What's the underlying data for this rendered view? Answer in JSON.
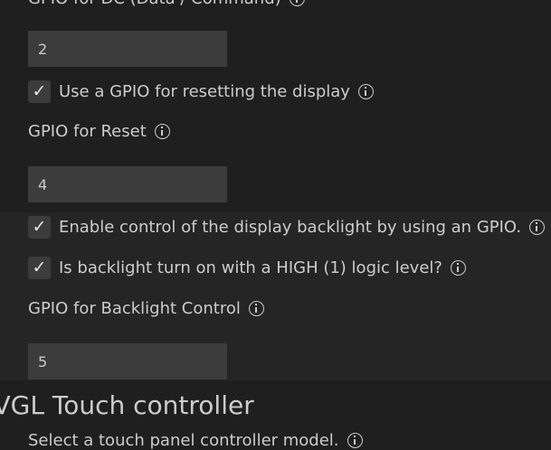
{
  "top_label": {
    "text": "GPIO for DC (Data / Command)"
  },
  "dc_gpio": {
    "value": "2"
  },
  "reset_checkbox": {
    "checked_glyph": "✓",
    "label": "Use a GPIO for resetting the display"
  },
  "reset_gpio_label": {
    "text": "GPIO for Reset"
  },
  "reset_gpio": {
    "value": "4"
  },
  "backlight_enable": {
    "checked_glyph": "✓",
    "label": "Enable control of the display backlight by using an GPIO."
  },
  "backlight_level": {
    "checked_glyph": "✓",
    "label": "Is backlight turn on with a HIGH (1) logic level?"
  },
  "backlight_gpio_label": {
    "text": "GPIO for Backlight Control"
  },
  "backlight_gpio": {
    "value": "5"
  },
  "touch_section": {
    "title": "LVGL Touch controller"
  },
  "touch_model_label": {
    "text": "Select a touch panel controller model."
  },
  "icons": {
    "info": "info-icon",
    "check": "check-icon"
  },
  "colors": {
    "background": "#1f1f1f",
    "band": "#252526",
    "input": "#3c3c3c",
    "text": "#cccccc"
  }
}
